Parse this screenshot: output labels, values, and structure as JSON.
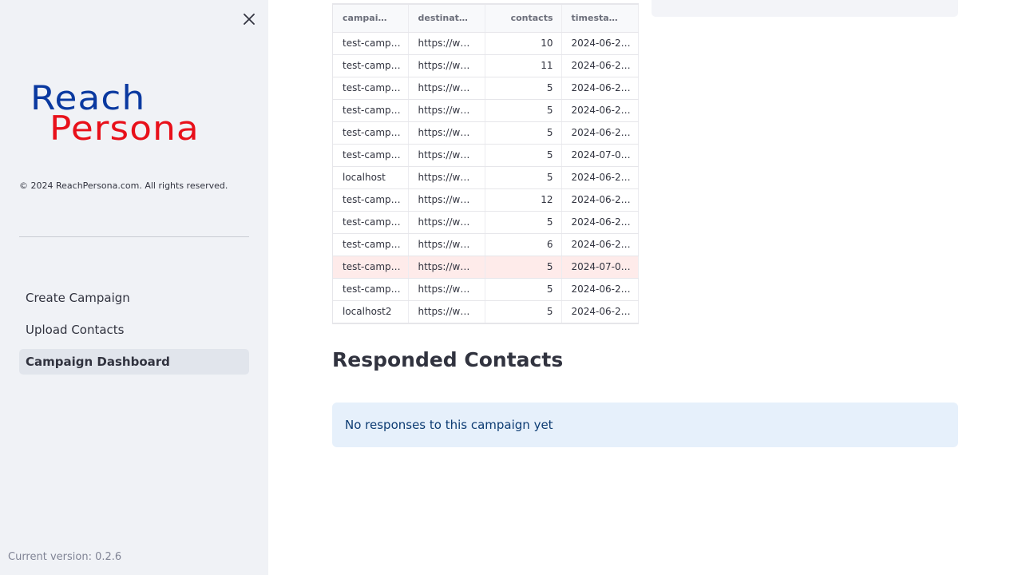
{
  "sidebar": {
    "logo": {
      "line1": "Reach",
      "line2": "Persona"
    },
    "copyright": "© 2024 ReachPersona.com. All rights reserved.",
    "nav": [
      {
        "label": "Create Campaign"
      },
      {
        "label": "Upload Contacts"
      },
      {
        "label": "Campaign Dashboard",
        "active": true
      }
    ],
    "version": "Current version: 0.2.6",
    "close_icon": "close-icon"
  },
  "table": {
    "columns": [
      "campai…",
      "destinat…",
      "contacts",
      "timesta…"
    ],
    "rows": [
      [
        "test-camp…",
        "https://w…",
        "10",
        "2024-06-2…"
      ],
      [
        "test-camp…",
        "https://w…",
        "11",
        "2024-06-2…"
      ],
      [
        "test-camp…",
        "https://w…",
        "5",
        "2024-06-2…"
      ],
      [
        "test-camp…",
        "https://w…",
        "5",
        "2024-06-2…"
      ],
      [
        "test-camp…",
        "https://w…",
        "5",
        "2024-06-2…"
      ],
      [
        "test-camp…",
        "https://w…",
        "5",
        "2024-07-0…"
      ],
      [
        "localhost",
        "https://w…",
        "5",
        "2024-06-2…"
      ],
      [
        "test-camp…",
        "https://w…",
        "12",
        "2024-06-2…"
      ],
      [
        "test-camp…",
        "https://w…",
        "5",
        "2024-06-2…"
      ],
      [
        "test-camp…",
        "https://w…",
        "6",
        "2024-06-2…"
      ],
      [
        "test-camp…",
        "https://w…",
        "5",
        "2024-07-0…"
      ],
      [
        "test-camp…",
        "https://w…",
        "5",
        "2024-06-2…"
      ],
      [
        "localhost2",
        "https://w…",
        "5",
        "2024-06-2…"
      ]
    ],
    "highlighted_row": 10
  },
  "main": {
    "section_title": "Responded Contacts",
    "info_message": "No responses to this campaign yet"
  },
  "colors": {
    "logo_blue": "#0a39a0",
    "logo_red": "#e8101a",
    "highlight_row": "#feebea",
    "info_bg": "#e6f0fb",
    "info_text": "#0d3c73"
  }
}
